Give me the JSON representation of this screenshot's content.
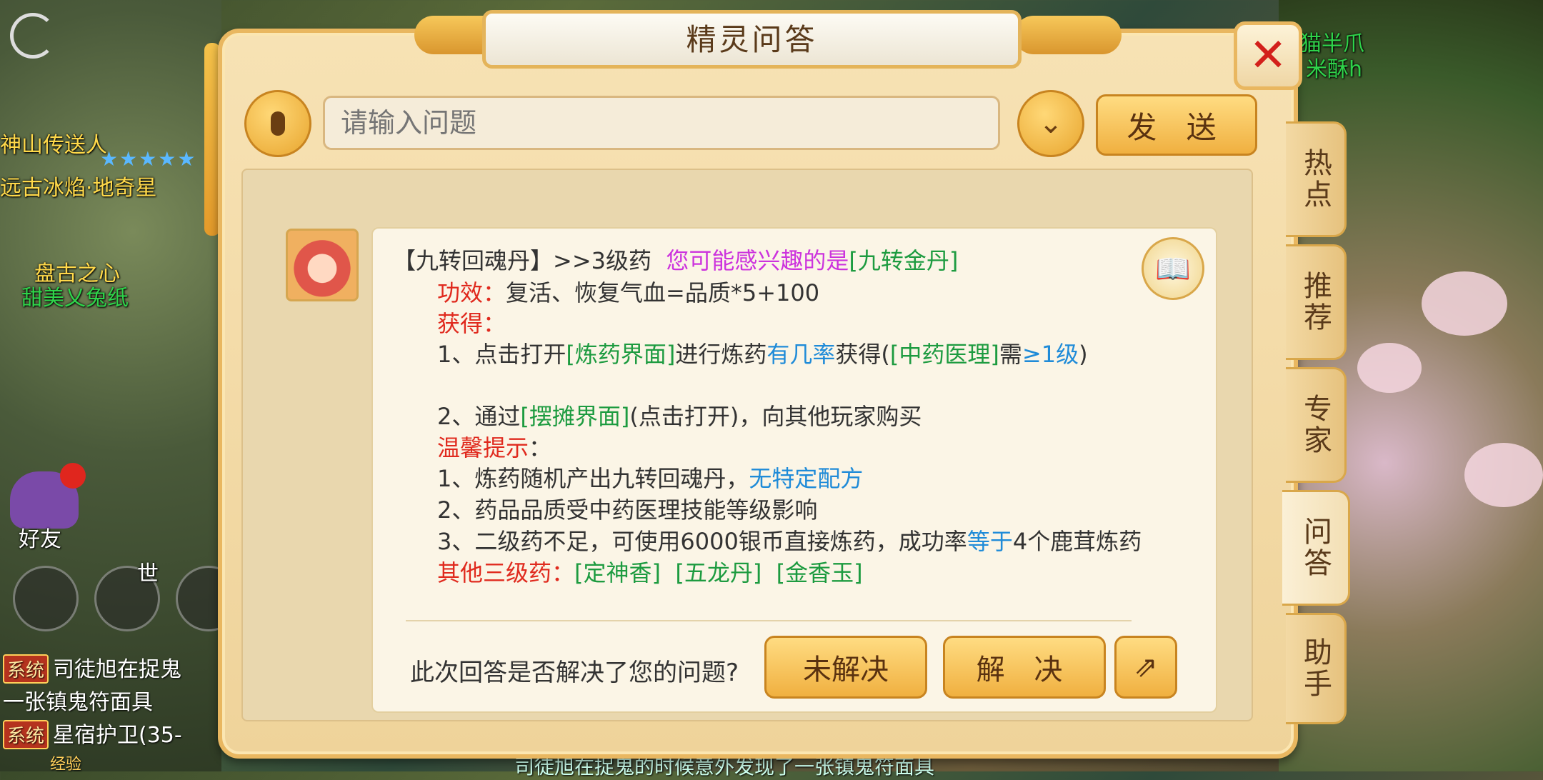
{
  "background": {
    "npc_names": [
      {
        "text": "神山传送人",
        "color": "yellow"
      },
      {
        "text": "远古冰焰·地奇星",
        "color": "yellow"
      },
      {
        "text": "盘古之心",
        "color": "green"
      },
      {
        "text": "甜美乂兔纸",
        "color": "green"
      },
      {
        "text": "猫半爪",
        "color": "green"
      },
      {
        "text": "米酥h",
        "color": "green"
      }
    ],
    "friend_label": "好友",
    "world_label": "世",
    "chat": [
      {
        "tag": "系统",
        "text": "司徒旭在捉鬼"
      },
      {
        "tag": "",
        "text": "一张镇鬼符面具"
      },
      {
        "tag": "系统",
        "text": "星宿护卫(35-"
      }
    ],
    "exp_label": "经验",
    "bottom_marquee": "司徒旭在捉鬼的时候意外发现了一张镇鬼符面具"
  },
  "dialog": {
    "title": "精灵问答",
    "input_placeholder": "请输入问题",
    "send_label": "发 送",
    "dropdown_icon": "chevron-down-icon",
    "answer": {
      "header": {
        "item": "【九转回魂丹】>>3级药",
        "hint": "您可能感兴趣的是",
        "link": "[九转金丹]"
      },
      "effect_label": "功效：",
      "effect_text": "复活、恢复气血=品质*5+100",
      "obtain_label": "获得：",
      "obtain1_prefix": "1、点击打开",
      "obtain1_link": "[炼药界面]",
      "obtain1_mid": "进行炼药",
      "obtain1_blue": "有几率",
      "obtain1_after": "获得(",
      "obtain1_link2": "[中药医理]",
      "obtain1_need": "需",
      "obtain1_level": "≥1级",
      "obtain1_close": ")",
      "obtain2_prefix": "2、通过",
      "obtain2_link": "[摆摊界面]",
      "obtain2_rest": "(点击打开)，向其他玩家购买",
      "tips_label": "温馨提示",
      "tips_colon": "：",
      "tip1_prefix": "1、炼药随机产出九转回魂丹，",
      "tip1_blue": "无特定配方",
      "tip2": "2、药品品质受中药医理技能等级影响",
      "tip3_prefix": "3、二级药不足，可使用6000银币直接炼药，成功率",
      "tip3_blue": "等于",
      "tip3_rest": "4个鹿茸炼药",
      "other_label": "其他三级药：",
      "other_items": [
        "[定神香]",
        "[五龙丹]",
        "[金香玉]"
      ]
    },
    "feedback_question": "此次回答是否解决了您的问题?",
    "unsolved_label": "未解决",
    "solved_label": "解 决"
  },
  "side_tabs": [
    "热点",
    "推荐",
    "专家",
    "问答",
    "助手"
  ],
  "active_tab": "问答",
  "colors": {
    "accent_gold": "#f0b040",
    "highlight_red": "#e02a1e",
    "link_green": "#1d9b40",
    "info_blue": "#1f8bd8",
    "hint_purple": "#cc33dd"
  }
}
